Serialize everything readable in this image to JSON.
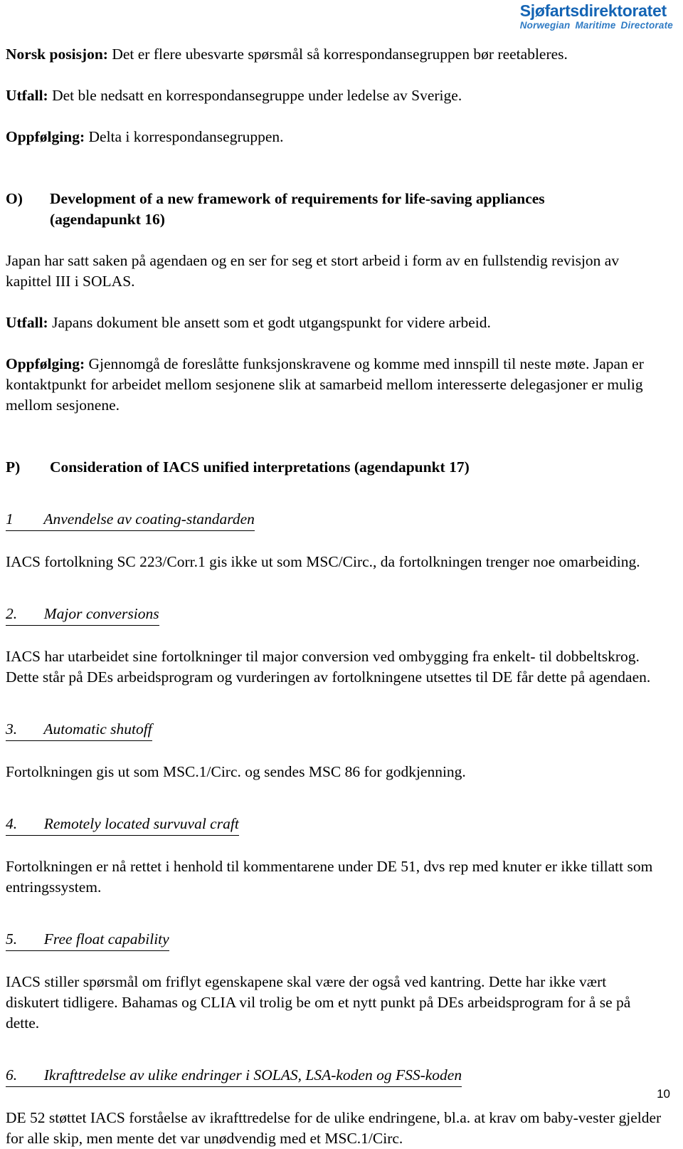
{
  "letterhead": {
    "organization": "Sjøfartsdirektoratet",
    "subtitle": "Norwegian  Maritime Directorate",
    "color": "#1464b4",
    "subtitle_color": "#2f7bc4"
  },
  "document": {
    "page_number": "10",
    "intro": {
      "norsk_posisjon_label": "Norsk posisjon:",
      "norsk_posisjon_text": " Det er flere ubesvarte spørsmål så korrespondansegruppen bør reetableres.",
      "utfall_label": "Utfall:",
      "utfall_text": " Det ble nedsatt en korrespondansegruppe under ledelse av Sverige.",
      "oppfolging_label": "Oppfølging:",
      "oppfolging_text": " Delta i korrespondansegruppen."
    },
    "section_o": {
      "marker": "O)",
      "title_line1": "Development of a new framework of requirements for life-saving appliances",
      "title_line2": "(agendapunkt 16)",
      "body": "Japan har satt saken på agendaen og en ser for seg et stort arbeid i form av en fullstendig revisjon av kapittel III i SOLAS.",
      "utfall_label": "Utfall:",
      "utfall_text": " Japans dokument ble ansett som et godt utgangspunkt for videre arbeid.",
      "oppfolging_label": "Oppfølging:",
      "oppfolging_text": " Gjennomgå de foreslåtte funksjonskravene og komme med innspill til neste møte. Japan er kontaktpunkt for arbeidet mellom sesjonene slik at samarbeid mellom interesserte delegasjoner er mulig mellom sesjonene."
    },
    "section_p": {
      "marker": "P)",
      "title": "Consideration of IACS unified interpretations (agendapunkt 17)",
      "items": [
        {
          "number": "1",
          "heading": "Anvendelse av coating-standarden",
          "heading_full": "1\t  Anvendelse av coating-standarden",
          "body": "IACS fortolkning SC 223/Corr.1 gis ikke ut som MSC/Circ., da fortolkningen trenger noe omarbeiding."
        },
        {
          "number": "2.",
          "heading": "Major conversions",
          "heading_full": "2.\t  Major conversions",
          "body": "IACS har utarbeidet sine fortolkninger til major conversion ved ombygging fra enkelt- til dobbeltskrog. Dette står på DEs arbeidsprogram og vurderingen av fortolkningene utsettes til DE får dette på agendaen."
        },
        {
          "number": "3.",
          "heading": "Automatic shutoff",
          "heading_full": "3.\t  Automatic shutoff",
          "body": "Fortolkningen gis ut som MSC.1/Circ. og sendes MSC 86 for godkjenning."
        },
        {
          "number": "4.",
          "heading": "Remotely located survuval craft",
          "heading_full": "4.\t  Remotely located survuval craft",
          "body": "Fortolkningen er nå rettet i henhold til kommentarene under DE 51, dvs rep med knuter er ikke tillatt som entringssystem."
        },
        {
          "number": "5.",
          "heading": "Free float capability",
          "heading_full": "5.\t  Free float capability",
          "body": "IACS stiller spørsmål om friflyt egenskapene skal være der også ved kantring. Dette har ikke vært diskutert tidligere. Bahamas og CLIA vil trolig be om et nytt punkt på DEs arbeidsprogram for å se på dette."
        },
        {
          "number": "6.",
          "heading": "Ikrafttredelse av ulike endringer i SOLAS, LSA-koden og FSS-koden",
          "heading_full": "6.\t  Ikrafttredelse av ulike endringer i SOLAS, LSA-koden og FSS-koden",
          "body": "DE 52 støttet IACS forståelse av ikrafttredelse for de ulike endringene, bl.a. at krav om baby-vester gjelder for alle skip, men mente det var unødvendig med et MSC.1/Circ."
        }
      ]
    }
  }
}
